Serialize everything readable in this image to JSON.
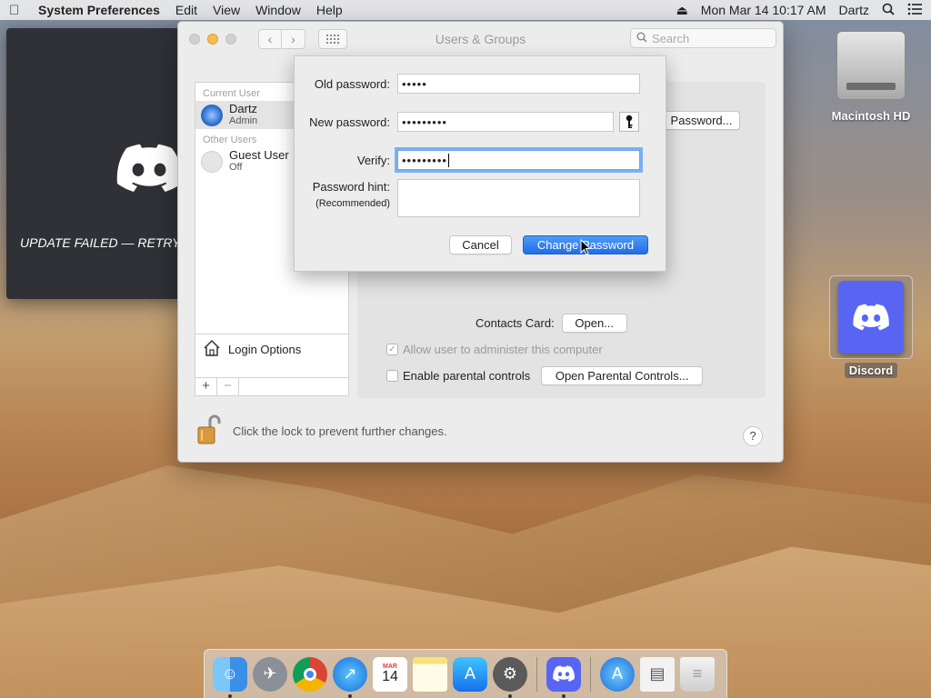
{
  "menubar": {
    "app": "System Preferences",
    "menus": [
      "Edit",
      "View",
      "Window",
      "Help"
    ],
    "datetime": "Mon Mar 14  10:17 AM",
    "user": "Dartz"
  },
  "discord_window": {
    "message": "UPDATE FAILED — RETRY"
  },
  "window": {
    "title": "Users & Groups",
    "search_placeholder": "Search"
  },
  "sidebar": {
    "current_header": "Current User",
    "current_user": {
      "name": "Dartz",
      "role": "Admin"
    },
    "other_header": "Other Users",
    "other_user": {
      "name": "Guest User",
      "role": "Off"
    },
    "login_options": "Login Options",
    "add_label": "+",
    "remove_label": "−"
  },
  "content": {
    "password_button": "Password...",
    "contacts_label": "Contacts Card:",
    "open_button": "Open...",
    "allow_admin": "Allow user to administer this computer",
    "parental_label": "Enable parental controls",
    "parental_button": "Open Parental Controls..."
  },
  "footer": {
    "lock_text": "Click the lock to prevent further changes.",
    "help": "?"
  },
  "sheet": {
    "old_label": "Old password:",
    "old_value": "•••••",
    "new_label": "New password:",
    "new_value": "•••••••••",
    "verify_label": "Verify:",
    "verify_value": "•••••••••",
    "hint_label": "Password hint:",
    "hint_sub": "(Recommended)",
    "hint_value": "",
    "cancel": "Cancel",
    "change": "Change Password"
  },
  "desktop": {
    "hd_label": "Macintosh HD",
    "discord_label": "Discord"
  },
  "dock": {
    "calendar_month": "MAR",
    "calendar_day": "14"
  },
  "colors": {
    "accent": "#1f6ce8",
    "discord": "#5865f2"
  }
}
